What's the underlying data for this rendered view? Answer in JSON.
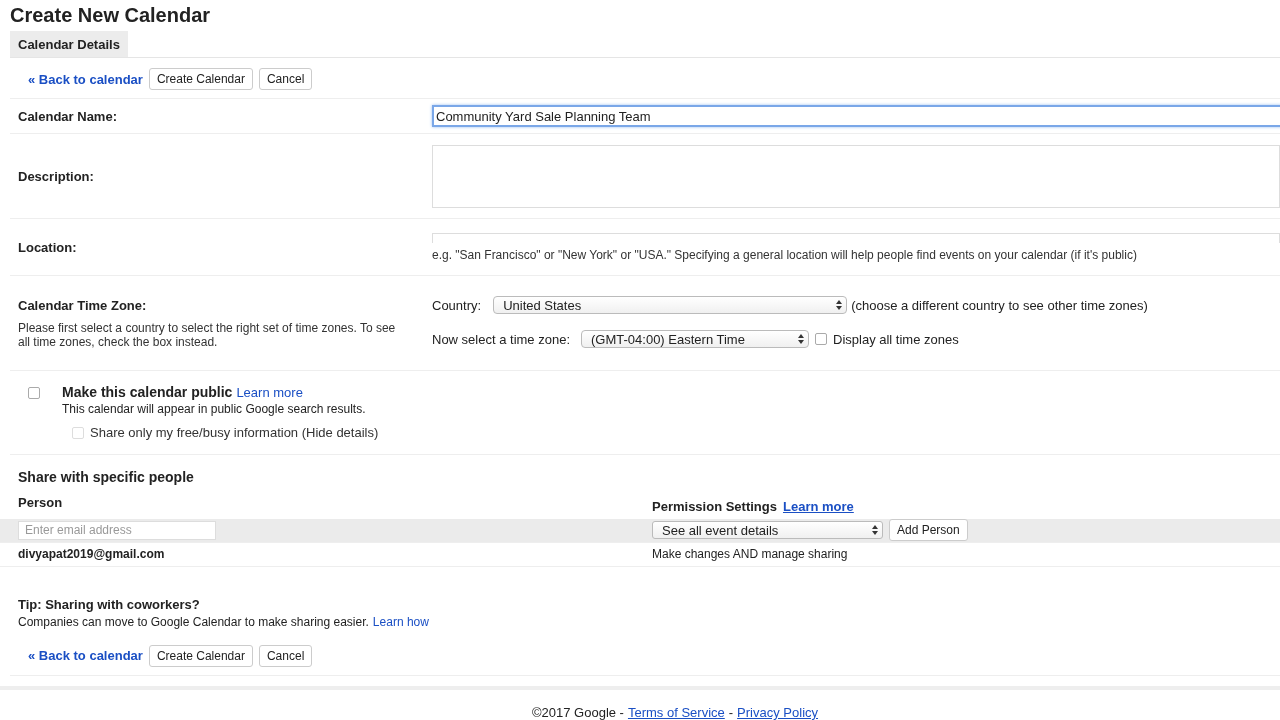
{
  "title": "Create New Calendar",
  "tabs": [
    {
      "label": "Calendar Details",
      "selected": true
    }
  ],
  "top_actions": {
    "back": "« Back to calendar",
    "create": "Create Calendar",
    "cancel": "Cancel"
  },
  "name_field": {
    "label": "Calendar Name:",
    "value": "Community Yard Sale Planning Team",
    "focused": true
  },
  "description_field": {
    "label": "Description:"
  },
  "location_field": {
    "label": "Location:",
    "hint": "e.g. \"San Francisco\" or \"New York\" or \"USA.\" Specifying a general location will help people find events on your calendar (if it's public)"
  },
  "time_zone": {
    "label": "Calendar Time Zone:",
    "help": "Please first select a country to select the right set of time zones. To see all time zones, check the box instead.",
    "country_label": "Country:",
    "country": "United States",
    "country_note": "(choose a different country to see other time zones)",
    "zone_label": "Now select a time zone:",
    "zone": "(GMT-04:00) Eastern Time",
    "display_all": {
      "label": "Display all time zones",
      "checked": false
    }
  },
  "public": {
    "label": "Make this calendar public",
    "checked": false,
    "learn_more": "Learn more",
    "note": "This calendar will appear in public Google search results.",
    "free_busy": {
      "label": "Share only my free/busy information (Hide details)",
      "checked": false,
      "disabled": true
    }
  },
  "sharing": {
    "heading": "Share with specific people",
    "person_header": "Person",
    "permission_header": "Permission Settings",
    "learn_more": "Learn more",
    "email_placeholder": "Enter email address",
    "permission": "See all event details",
    "add_button": "Add Person",
    "rows": [
      {
        "person": "divyapat2019@gmail.com",
        "permission": "Make changes AND manage sharing"
      }
    ]
  },
  "tip": {
    "title": "Tip: Sharing with coworkers?",
    "text": "Companies can move to Google Calendar to make sharing easier.",
    "link": "Learn how"
  },
  "bottom_actions": {
    "back": "« Back to calendar",
    "create": "Create Calendar",
    "cancel": "Cancel"
  },
  "footer": {
    "copyright": "©2017 Google -",
    "terms": "Terms of Service",
    "separator": "-",
    "privacy": "Privacy Policy"
  }
}
